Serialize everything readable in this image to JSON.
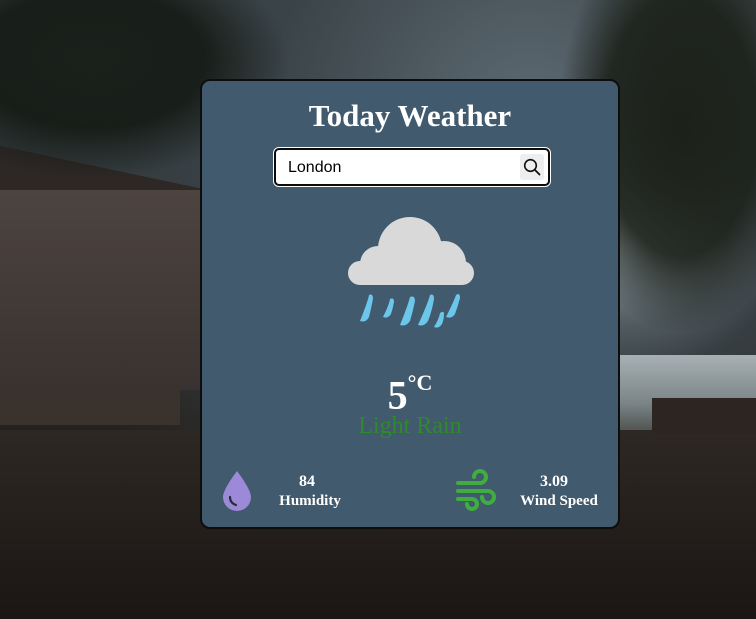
{
  "app": {
    "title": "Today Weather"
  },
  "search": {
    "value": "London",
    "button_icon": "search-icon"
  },
  "current": {
    "icon": "rain-cloud-icon",
    "temperature": "5",
    "unit": "°C",
    "description": "Light Rain",
    "description_color": "#2e8a2a"
  },
  "stats": {
    "humidity": {
      "icon": "water-drop-icon",
      "value": "84",
      "label": "Humidity",
      "icon_color": "#9c89d8"
    },
    "wind": {
      "icon": "wind-icon",
      "value": "3.09",
      "label": "Wind Speed",
      "icon_color": "#3fae3f"
    }
  },
  "colors": {
    "card_bg": "#415a6e",
    "text": "#ffffff"
  }
}
